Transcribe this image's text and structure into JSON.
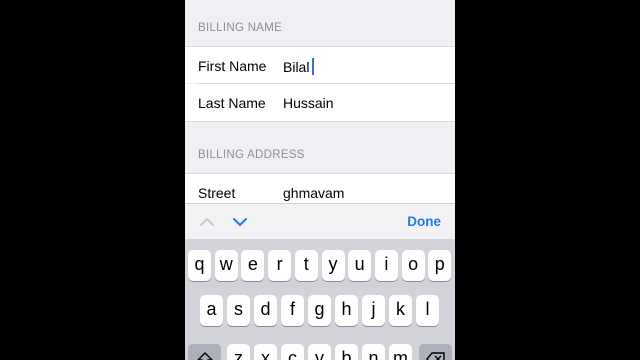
{
  "billing_name": {
    "header": "BILLING NAME",
    "first_name_label": "First Name",
    "first_name_value": "Bilal",
    "last_name_label": "Last Name",
    "last_name_value": "Hussain"
  },
  "billing_address": {
    "header": "BILLING ADDRESS",
    "street_label": "Street",
    "street_value": "ghmavam"
  },
  "accessory_bar": {
    "done_label": "Done",
    "prev_icon": "chevron-up-icon",
    "next_icon": "chevron-down-icon"
  },
  "keyboard": {
    "row1": [
      "q",
      "w",
      "e",
      "r",
      "t",
      "y",
      "u",
      "i",
      "o",
      "p"
    ],
    "row2": [
      "a",
      "s",
      "d",
      "f",
      "g",
      "h",
      "j",
      "k",
      "l"
    ],
    "row3": [
      "z",
      "x",
      "c",
      "v",
      "b",
      "n",
      "m"
    ],
    "shift_icon": "shift-icon",
    "delete_icon": "backspace-icon"
  },
  "colors": {
    "accent": "#1e7be6",
    "cursor": "#3b6de0",
    "keyboard_bg": "#d1d3d9"
  }
}
